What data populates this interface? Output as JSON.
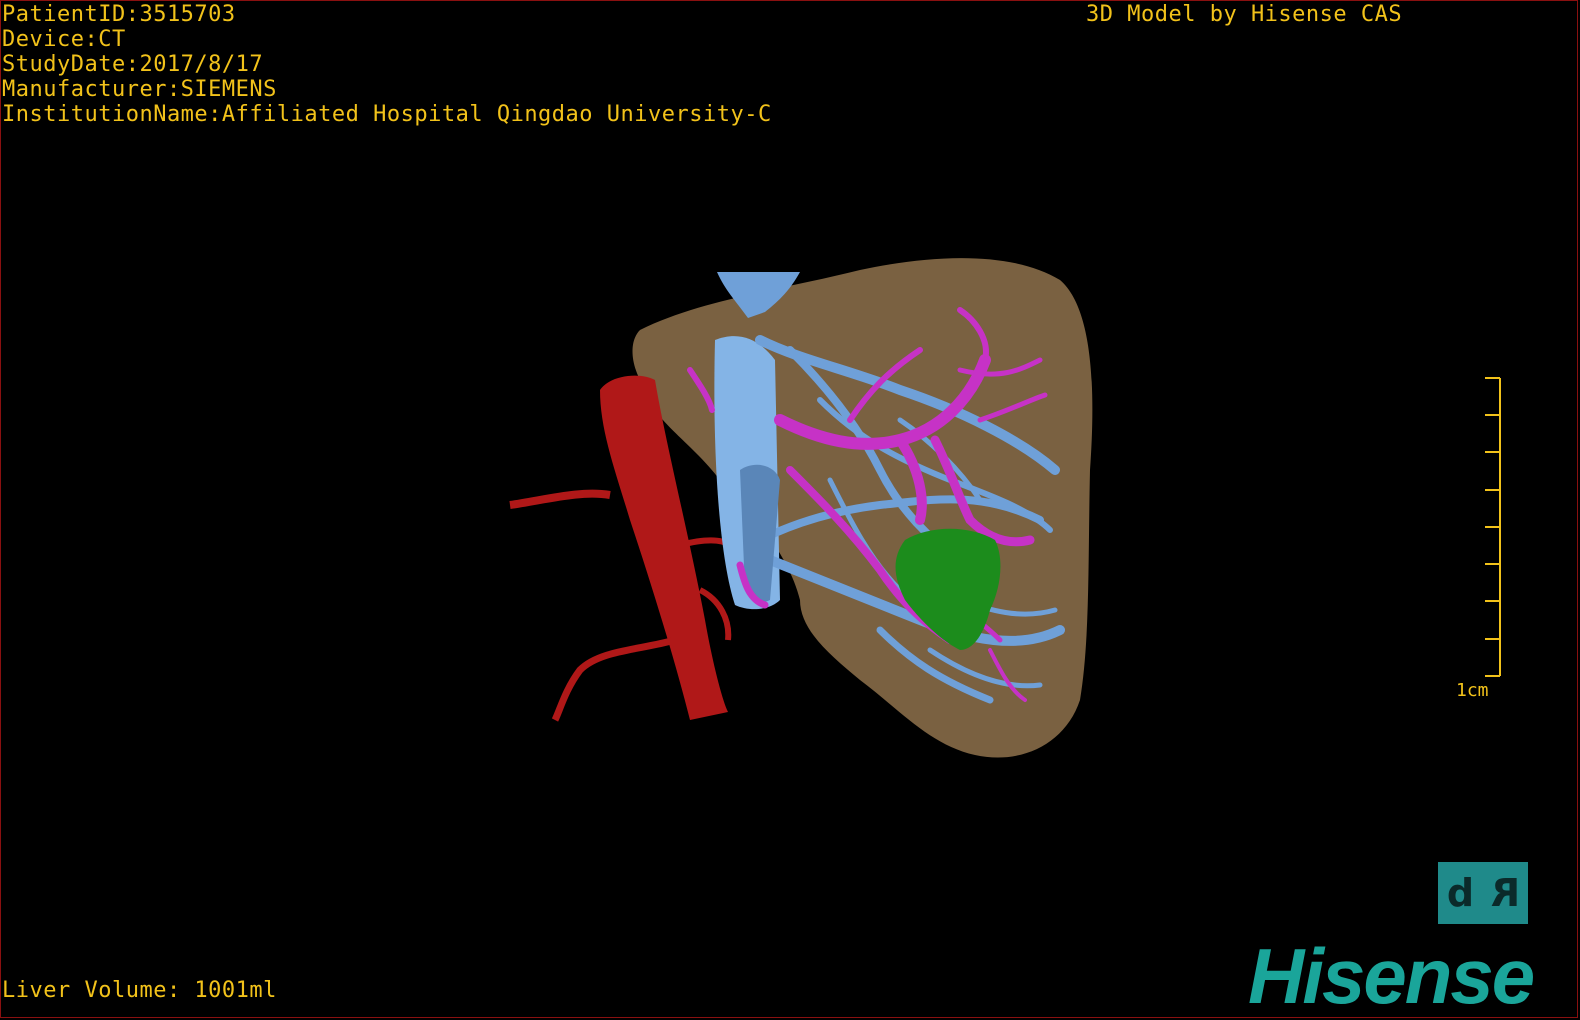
{
  "overlay": {
    "info_lines": [
      "PatientID:3515703",
      "Device:CT",
      "StudyDate:2017/8/17",
      "Manufacturer:SIEMENS",
      "InstitutionName:Affiliated Hospital Qingdao University-C"
    ],
    "brand": "3D Model by Hisense CAS",
    "volume": "Liver Volume: 1001ml",
    "scale_label": "1cm"
  },
  "orientation": {
    "left": "d",
    "right": "R"
  },
  "logo": {
    "text": "Hisense"
  },
  "colors": {
    "text": "#f2c21a",
    "liver": "#7a6141",
    "portal_vein": "#6fa0d8",
    "hepatic_vein": "#c632c6",
    "aorta": "#b01818",
    "lesion": "#1c8c1c",
    "logo": "#1aa59a",
    "border": "#8a1010"
  }
}
